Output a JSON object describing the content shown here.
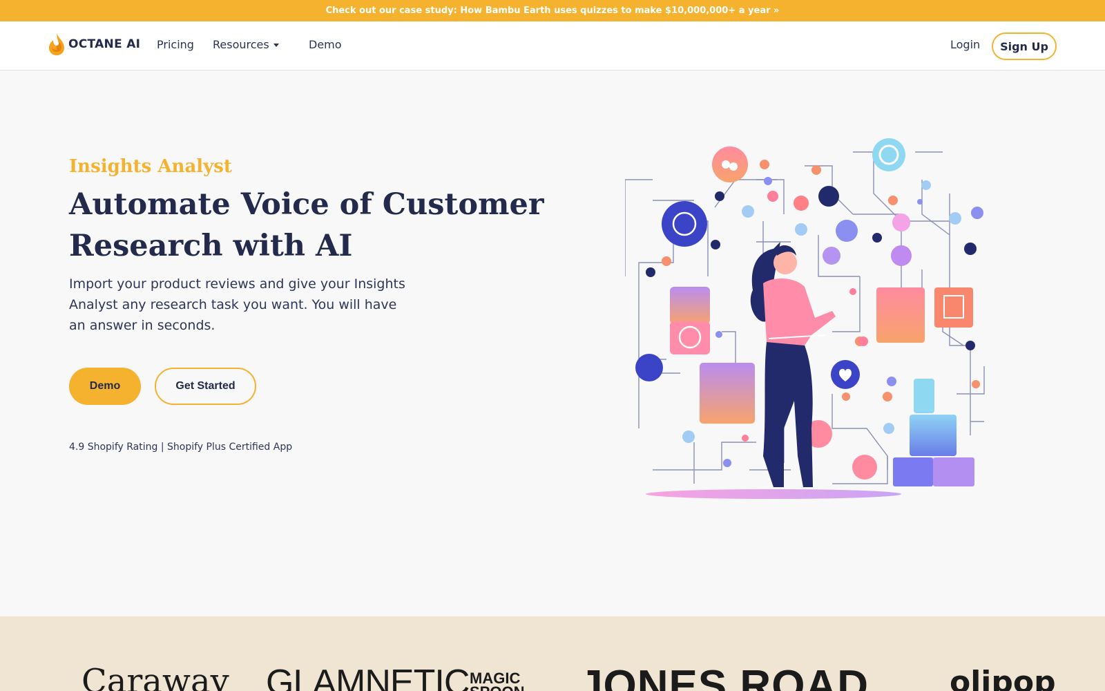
{
  "announcement": {
    "text": "Check out our case study: How Bambu Earth uses quizzes to make $10,000,000+ a year »"
  },
  "nav": {
    "logo_text": "OCTANE AI",
    "links": [
      {
        "label": "Pricing"
      },
      {
        "label": "Resources"
      },
      {
        "label": "Demo"
      }
    ],
    "login": "Login",
    "signup": "Sign Up"
  },
  "hero": {
    "eyebrow": "Insights Analyst",
    "headline": "Automate Voice of Customer Research with AI",
    "subheadline": "Import your product reviews and give your Insights Analyst any research task you want. You will have an answer in seconds.",
    "demo_button": "Demo",
    "start_button": "Get Started",
    "rating": "4.9 Shopify Rating | Shopify Plus Certified App"
  },
  "brand_logos": [
    "Caraway",
    "GLAMNETIC",
    "MAGIC SPOON",
    "JONES ROAD",
    "olipop"
  ],
  "colors": {
    "accent": "#f5b22e",
    "navy": "#232a4b",
    "hero_bg": "#f8f8f8",
    "logos_bg": "#f0e4d3"
  }
}
